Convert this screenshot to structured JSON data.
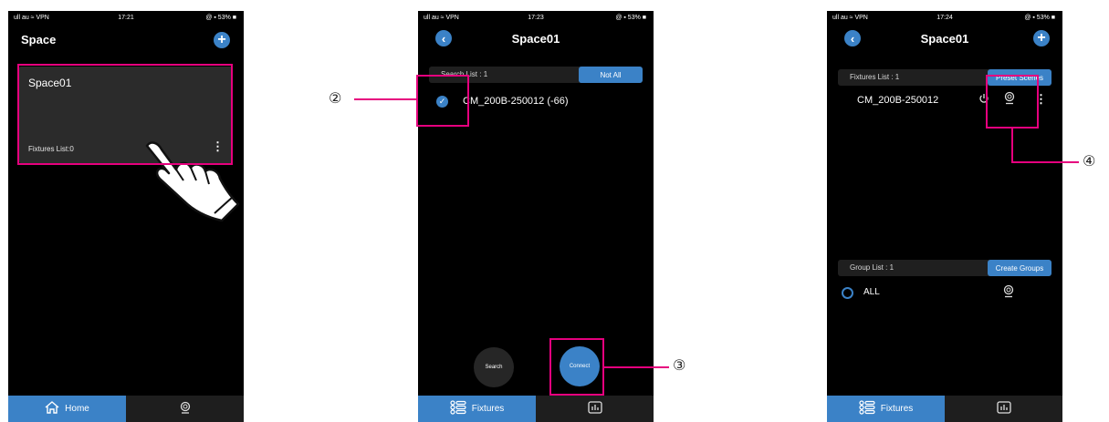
{
  "status": {
    "carrier": "ull au ≈ VPN",
    "battery": "@ ▪ 53% ■",
    "time1": "17:21",
    "time2": "17:23",
    "time3": "17:24"
  },
  "screen1": {
    "title": "Space",
    "add_label": "+",
    "card": {
      "name": "Space01",
      "fixtures": "Fixtures List:0",
      "more": "⋮"
    },
    "tabs": {
      "home": "Home"
    }
  },
  "screen2": {
    "title": "Space01",
    "back_label": "‹",
    "search_list": "Search List : 1",
    "not_all": "Not All",
    "device": "CM_200B-250012  (-66)",
    "search_btn": "Search",
    "connect_btn": "Connect",
    "tabs": {
      "fixtures": "Fixtures"
    }
  },
  "screen3": {
    "title": "Space01",
    "back_label": "‹",
    "add_label": "+",
    "fixtures_list": "Fixtures List : 1",
    "preset_scenes": "Preset Scenes",
    "device": "CM_200B-250012",
    "more": "⋮",
    "group_list": "Group List : 1",
    "create_groups": "Create Groups",
    "group_name": "ALL",
    "tabs": {
      "fixtures": "Fixtures"
    }
  },
  "callouts": {
    "n2": "②",
    "n3": "③",
    "n4": "④"
  },
  "colors": {
    "accent": "#3b82c7",
    "highlight": "#e6007e",
    "card": "#2b2b2b"
  }
}
